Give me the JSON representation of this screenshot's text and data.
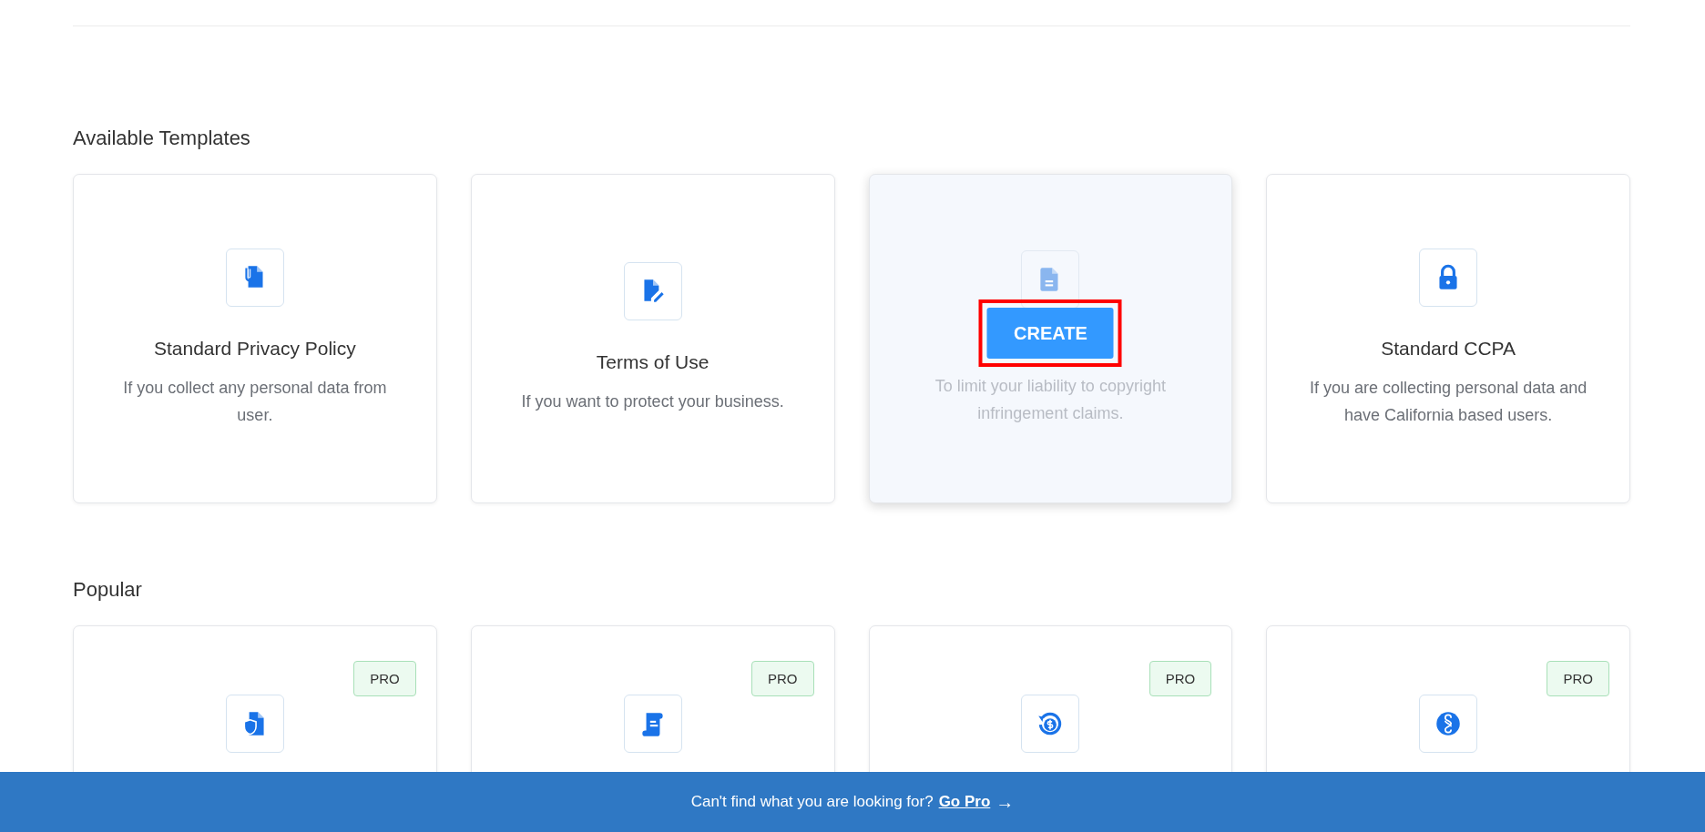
{
  "sections": [
    {
      "title": "Available Templates",
      "cards": [
        {
          "title": "Standard Privacy Policy",
          "description": "If you collect any personal data from user.",
          "hovered": false
        },
        {
          "title": "Terms of Use",
          "description": "If you want to protect your business.",
          "hovered": false
        },
        {
          "description": "To limit your liability to copyright infringement claims.",
          "hovered": true,
          "action": {
            "label": "CREATE",
            "highlighted": true
          }
        },
        {
          "title": "Standard CCPA",
          "description": "If you are collecting personal data and have California based users.",
          "hovered": false
        }
      ]
    },
    {
      "title": "Popular",
      "cards": [
        {
          "badge": "PRO",
          "hovered": false
        },
        {
          "badge": "PRO",
          "hovered": false
        },
        {
          "badge": "PRO",
          "hovered": false
        },
        {
          "badge": "PRO",
          "hovered": false
        }
      ]
    }
  ],
  "footer_bar": {
    "text": "Can't find what you are looking for?",
    "link": "Go Pro",
    "arrow": "→"
  }
}
